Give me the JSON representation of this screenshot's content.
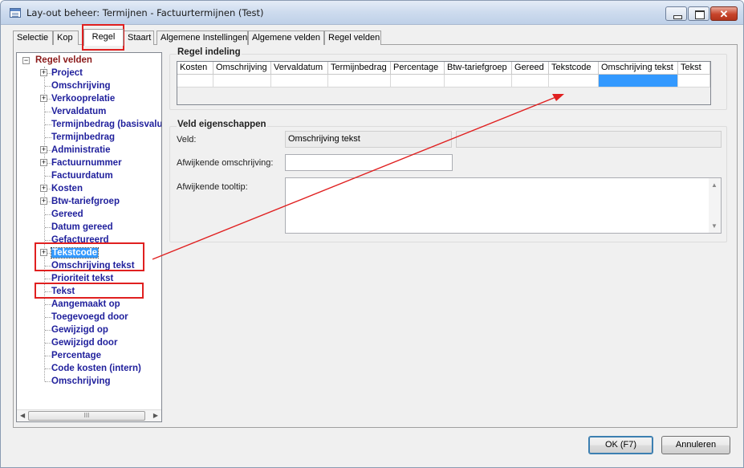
{
  "window": {
    "title": "Lay-out beheer: Termijnen - Factuurtermijnen (Test)"
  },
  "tabs": [
    "Selectie",
    "Kop",
    "Regel",
    "Staart",
    "Algemene Instellingen",
    "Algemene velden",
    "Regel velden"
  ],
  "active_tab": "Regel",
  "tree": {
    "root": "Regel velden",
    "items": [
      {
        "label": "Project",
        "expandable": true
      },
      {
        "label": "Omschrijving",
        "expandable": false
      },
      {
        "label": "Verkooprelatie",
        "expandable": true
      },
      {
        "label": "Vervaldatum",
        "expandable": false
      },
      {
        "label": "Termijnbedrag (basisvaluta)",
        "expandable": false
      },
      {
        "label": "Termijnbedrag",
        "expandable": false
      },
      {
        "label": "Administratie",
        "expandable": true
      },
      {
        "label": "Factuurnummer",
        "expandable": true
      },
      {
        "label": "Factuurdatum",
        "expandable": false
      },
      {
        "label": "Kosten",
        "expandable": true
      },
      {
        "label": "Btw-tariefgroep",
        "expandable": true
      },
      {
        "label": "Gereed",
        "expandable": false
      },
      {
        "label": "Datum gereed",
        "expandable": false
      },
      {
        "label": "Gefactureerd",
        "expandable": false
      },
      {
        "label": "Tekstcode",
        "expandable": true
      },
      {
        "label": "Omschrijving tekst",
        "expandable": false
      },
      {
        "label": "Prioriteit tekst",
        "expandable": false
      },
      {
        "label": "Tekst",
        "expandable": false
      },
      {
        "label": "Aangemaakt op",
        "expandable": false
      },
      {
        "label": "Toegevoegd door",
        "expandable": false
      },
      {
        "label": "Gewijzigd op",
        "expandable": false
      },
      {
        "label": "Gewijzigd door",
        "expandable": false
      },
      {
        "label": "Percentage",
        "expandable": false
      },
      {
        "label": "Code kosten (intern)",
        "expandable": false
      },
      {
        "label": "Omschrijving",
        "expandable": false
      }
    ],
    "selected": "Tekstcode",
    "scrollbar_glyph": "III"
  },
  "regel_indeling": {
    "title": "Regel indeling",
    "columns": [
      "Kosten",
      "Omschrijving",
      "Vervaldatum",
      "Termijnbedrag",
      "Percentage",
      "Btw-tariefgroep",
      "Gereed",
      "Tekstcode",
      "Omschrijving tekst",
      "Tekst"
    ],
    "selected_column": "Omschrijving tekst"
  },
  "veld_eigenschappen": {
    "title": "Veld eigenschappen",
    "veld_label": "Veld:",
    "veld_value": "Omschrijving tekst",
    "afwijkende_omschrijving_label": "Afwijkende omschrijving:",
    "afwijkende_omschrijving_value": "",
    "afwijkende_tooltip_label": "Afwijkende tooltip:",
    "afwijkende_tooltip_value": ""
  },
  "buttons": {
    "ok": "OK (F7)",
    "cancel": "Annuleren"
  },
  "colors": {
    "selection": "#3399ff",
    "tree_text": "#1f1f9c",
    "tree_root": "#8b1a1a",
    "annotation": "#e02020"
  }
}
